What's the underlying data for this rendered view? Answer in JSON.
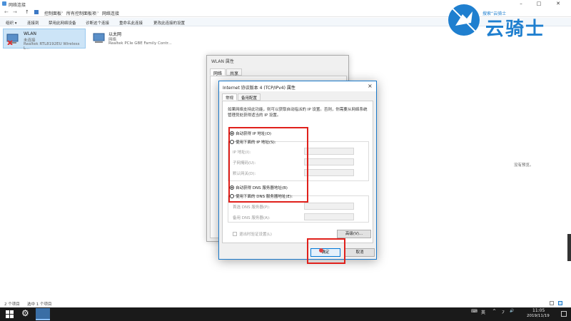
{
  "window": {
    "title": "网络连接"
  },
  "nav": {
    "back": "←",
    "forward": "→",
    "up": "↑"
  },
  "breadcrumb": [
    "控制面板",
    "所有控制面板项",
    "网络连接"
  ],
  "toolbar": [
    "组织 ▾",
    "连接到",
    "禁用此网络设备",
    "诊断这个连接",
    "重命名此连接",
    "更改此连接的设置"
  ],
  "adapters": [
    {
      "name": "WLAN",
      "status": "未连接",
      "device": "Realtek RTL8192EU Wireless L..."
    },
    {
      "name": "以太网",
      "status": "网络",
      "device": "Realtek PCIe GBE Family Contr..."
    }
  ],
  "preview": {
    "text": "没有预览。"
  },
  "statusbar": {
    "items": "2 个项目",
    "selected": "选中 1 个项目"
  },
  "watermark": {
    "small": "搜索“云骑士",
    "brand": "云骑士"
  },
  "wlan_dialog": {
    "title": "WLAN 属性",
    "tabs": [
      "网络",
      "共享"
    ]
  },
  "ipv4_dialog": {
    "title": "Internet 协议版本 4 (TCP/IPv4) 属性",
    "close": "×",
    "tabs": [
      "常规",
      "备用配置"
    ],
    "description": "如果网络支持此功能，则可以获取自动指派的 IP 设置。否则，你需要从网络系统管理员处获得适当的 IP 设置。",
    "ip_auto": "自动获得 IP 地址(O)",
    "ip_manual": "使用下面的 IP 地址(S):",
    "ip_fields": [
      "IP 地址(I):",
      "子网掩码(U):",
      "默认网关(D):"
    ],
    "dns_auto": "自动获得 DNS 服务器地址(B)",
    "dns_manual": "使用下面的 DNS 服务器地址(E):",
    "dns_fields": [
      "首选 DNS 服务器(P):",
      "备用 DNS 服务器(A):"
    ],
    "validate": "退出时验证设置(L)",
    "advanced": "高级(V)...",
    "ok": "确定",
    "cancel": "取消"
  },
  "taskbar": {
    "time": "11:05",
    "date": "2019/11/19",
    "ime": "英",
    "tray_icons": [
      "^",
      "㇇",
      "🔊"
    ]
  },
  "colors": {
    "accent": "#1979ca",
    "highlight_box": "#e0201b",
    "taskbar": "#1a1a1a",
    "selection": "#cce4f7"
  }
}
